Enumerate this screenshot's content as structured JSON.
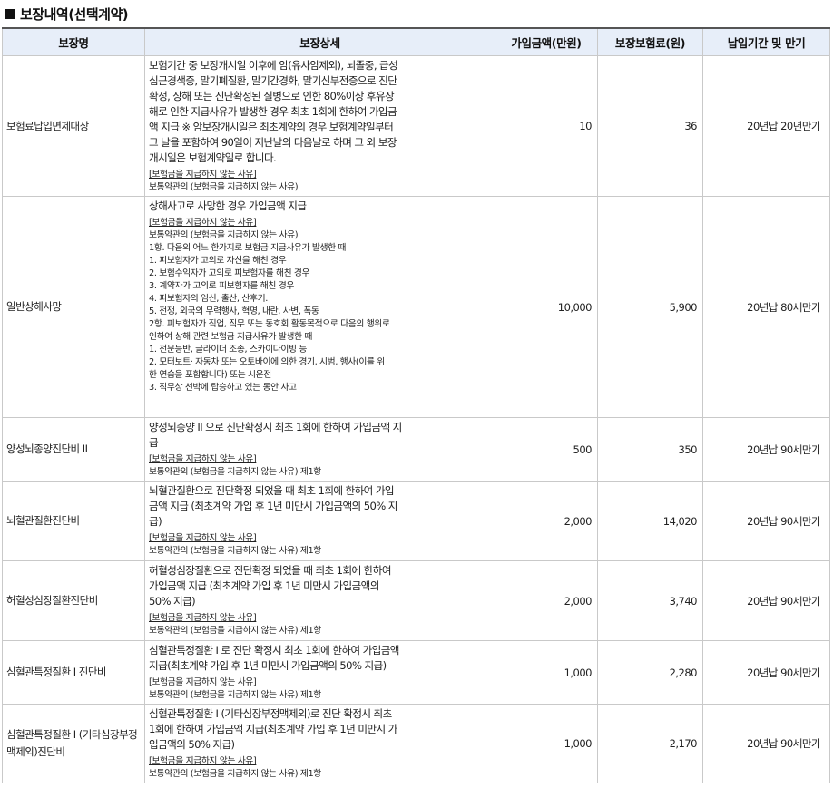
{
  "section_title": "보장내역(선택계약)",
  "headers": [
    "보장명",
    "보장상세",
    "가입금액(만원)",
    "보장보험료(원)",
    "납입기간 및 만기"
  ],
  "rows": [
    {
      "name": "보험료납입면제대상",
      "desc": [
        "보험기간 중 보장개시일 이후에 암(유사암제외), 뇌졸중, 급성",
        "심근경색증, 말기폐질환, 말기간경화, 말기신부전증으로 진단",
        "확정, 상해 또는 진단확정된 질병으로 인한 80%이상 후유장",
        "해로 인한 지급사유가 발생한 경우 최초 1회에 한하여 가입금",
        "액 지급 ※ 암보장개시일은 최초계약의 경우 보험계약일부터",
        "그 날을 포함하여 90일이 지난날의 다음날로 하며 그 외 보장",
        "개시일은 보험계약일로 합니다."
      ],
      "exclusion_header": "[보험금을 지급하지 않는 사유]",
      "exclusion_lines": [
        "보통약관의 (보험금을 지급하지 않는 사유)"
      ],
      "amount": "10",
      "premium": "36",
      "term": "20년납 20년만기"
    },
    {
      "name": "일반상해사망",
      "desc": [
        "상해사고로 사망한 경우 가입금액 지급"
      ],
      "exclusion_header": "[보험금을 지급하지 않는 사유]",
      "exclusion_lines": [
        "보통약관의 (보험금을 지급하지 않는 사유)",
        "1항. 다음의 어느 한가지로 보험금 지급사유가 발생한 때",
        "1. 피보험자가 고의로 자신을 해친 경우",
        "2. 보험수익자가 고의로 피보험자를 해친 경우",
        "3. 계약자가 고의로 피보험자를 해친 경우",
        "4. 피보험자의 임신, 출산, 산후기.",
        "5. 전쟁, 외국의 무력행사, 혁명, 내란, 사변, 폭동",
        "2항. 피보험자가 직업, 직무 또는 동호회 활동목적으로 다음의 행위로",
        "인하여 상해 관련 보험금 지급사유가 발생한 때",
        "1. 전문등반, 글라이더 조종, 스카이다이빙 등",
        "2. 모터보트· 자동차 또는 오토바이에 의한 경기, 시범, 행사(이를 위",
        "한 연습을 포함합니다) 또는 시운전",
        "3. 직무상 선박에 탑승하고 있는 동안 사고"
      ],
      "amount": "10,000",
      "premium": "5,900",
      "term": "20년납 80세만기"
    },
    {
      "name": "양성뇌종양진단비 II",
      "desc": [
        "양성뇌종양 II 으로 진단확정시 최초 1회에 한하여 가입금액 지",
        "급"
      ],
      "exclusion_header": "[보험금을 지급하지 않는 사유]",
      "exclusion_lines": [
        "보통약관의 (보험금을 지급하지 않는 사유) 제1항"
      ],
      "amount": "500",
      "premium": "350",
      "term": "20년납 90세만기"
    },
    {
      "name": "뇌혈관질환진단비",
      "desc": [
        "뇌혈관질환으로 진단확정 되었을 때 최초 1회에 한하여 가입",
        "금액 지급 (최초계약 가입 후 1년 미만시 가입금액의 50% 지",
        "급)"
      ],
      "exclusion_header": "[보험금을 지급하지 않는 사유]",
      "exclusion_lines": [
        "보통약관의 (보험금을 지급하지 않는 사유) 제1항"
      ],
      "amount": "2,000",
      "premium": "14,020",
      "term": "20년납 90세만기"
    },
    {
      "name": "허혈성심장질환진단비",
      "desc": [
        "허혈성심장질환으로 진단확정 되었을 때 최초 1회에 한하여",
        "가입금액 지급 (최초계약 가입 후 1년 미만시 가입금액의",
        "50% 지급)"
      ],
      "exclusion_header": "[보험금을 지급하지 않는 사유]",
      "exclusion_lines": [
        "보통약관의 (보험금을 지급하지 않는 사유) 제1항"
      ],
      "amount": "2,000",
      "premium": "3,740",
      "term": "20년납 90세만기"
    },
    {
      "name": "심혈관특정질환 I 진단비",
      "desc": [
        "심혈관특정질환 I 로 진단 확정시 최초 1회에 한하여 가입금액",
        "지급(최초계약 가입 후 1년 미만시 가입금액의 50% 지급)"
      ],
      "exclusion_header": "[보험금을 지급하지 않는 사유]",
      "exclusion_lines": [
        "보통약관의 (보험금을 지급하지 않는 사유) 제1항"
      ],
      "amount": "1,000",
      "premium": "2,280",
      "term": "20년납 90세만기"
    },
    {
      "name": "심혈관특정질환 I (기타심장부정맥제외)진단비",
      "desc": [
        "심혈관특정질환 I (기타심장부정맥제외)로 진단 확정시 최초",
        "1회에 한하여 가입금액 지급(최초계약 가입 후 1년 미만시 가",
        "입금액의 50% 지급)"
      ],
      "exclusion_header": "[보험금을 지급하지 않는 사유]",
      "exclusion_lines": [
        "보통약관의 (보험금을 지급하지 않는 사유) 제1항"
      ],
      "amount": "1,000",
      "premium": "2,170",
      "term": "20년납 90세만기"
    }
  ]
}
